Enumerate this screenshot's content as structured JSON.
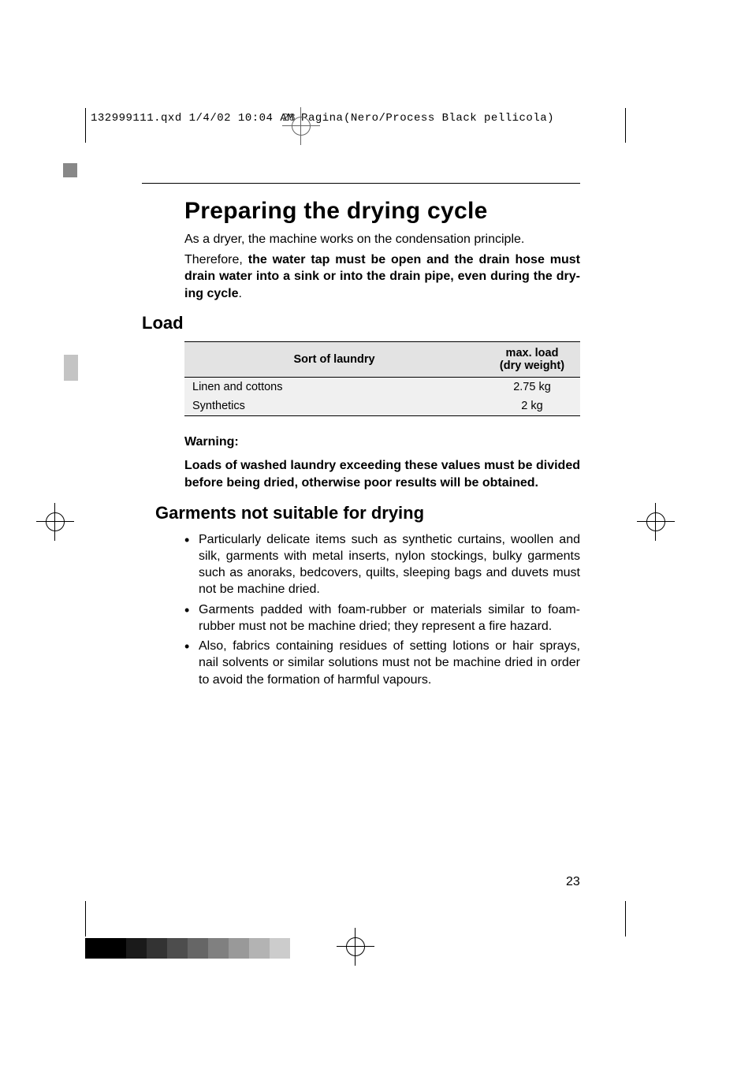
{
  "slug": {
    "left": "132999111.qxd  1/4/02  10:04 AM  Pagina",
    "page": "23",
    "right": "(Nero/Process Black pellicola)"
  },
  "heading": "Preparing the drying cycle",
  "intro1": "As a dryer, the machine works on the condensation principle.",
  "intro2_pre": "Therefore, ",
  "intro2_bold": "the water tap must be open and the drain hose must drain water into a sink or into the drain pipe, even during the dry­ing cycle",
  "intro2_post": ".",
  "load_heading": "Load",
  "table": {
    "col1": "Sort of laundry",
    "col2_a": "max. load",
    "col2_b": "(dry weight)",
    "rows": [
      {
        "label": "Linen and cottons",
        "value": "2.75 kg"
      },
      {
        "label": "Synthetics",
        "value": "2 kg"
      }
    ]
  },
  "warning_head": "Warning:",
  "warning_body": "Loads of washed laundry exceeding these values must be divided before being dried, otherwise poor results will be obtained.",
  "garments_heading": "Garments not suitable for drying",
  "bullets": [
    "Particularly delicate items such as synthetic curtains, woollen and silk, garments with metal inserts, nylon stockings, bulky garments such as anoraks, bedcovers, quilts, sleeping bags and duvets must not be machine dried.",
    "Garments padded with foam-rubber or materials similar to foam-rubber must not be machine dried; they represent a fire hazard.",
    "Also, fabrics containing residues of setting lotions or hair sprays, nail solvents or similar solutions must not be machine dried in order to avoid the formation of harmful vapours."
  ],
  "page_number": "23",
  "grey_shades": [
    "#000000",
    "#000000",
    "#1a1a1a",
    "#333333",
    "#4d4d4d",
    "#666666",
    "#808080",
    "#999999",
    "#b3b3b3",
    "#cccccc"
  ],
  "chart_data": {
    "type": "table",
    "title": "Load",
    "columns": [
      "Sort of laundry",
      "max. load (dry weight)"
    ],
    "rows": [
      [
        "Linen and cottons",
        "2.75 kg"
      ],
      [
        "Synthetics",
        "2 kg"
      ]
    ]
  }
}
